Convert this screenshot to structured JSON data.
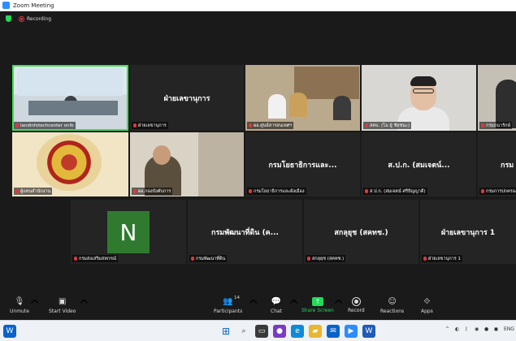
{
  "window": {
    "title": "Zoom Meeting"
  },
  "status": {
    "recording_label": "Recording"
  },
  "tiles": [
    {
      "id": "t1",
      "label": "landinfotechcenter onlb",
      "center": "",
      "active": true,
      "kind": "board"
    },
    {
      "id": "t2",
      "label": "ฝ่ายเลขานุการ",
      "center": "ฝ่ายเลขานุการ",
      "active": false,
      "kind": "blank"
    },
    {
      "id": "t3",
      "label": "ผอ.ศูนย์สารสนเทศฯ",
      "center": "",
      "active": false,
      "kind": "office"
    },
    {
      "id": "t4",
      "label": "สคบ. (โม ผู้ ชัยชนะ)",
      "center": "",
      "active": false,
      "kind": "portrait"
    },
    {
      "id": "t5",
      "label": "กรมธนารักษ์",
      "center": "",
      "active": false,
      "kind": "room"
    },
    {
      "id": "t6",
      "label": "ผู้แทนสำนักงาน",
      "center": "",
      "active": false,
      "kind": "seal"
    },
    {
      "id": "t7",
      "label": "ผอ.กองบังคับการ",
      "center": "",
      "active": false,
      "kind": "officer"
    },
    {
      "id": "t8",
      "label": "กรมโยธาธิการและผังเมือง",
      "center": "กรมโยธาธิการและ...",
      "active": false,
      "kind": "blank"
    },
    {
      "id": "t9",
      "label": "ส.ป.ก. (สมเจตน์ ศรีปัญญาดี)",
      "center": "ส.ป.ก. (สมเจตน์...",
      "active": false,
      "kind": "blank"
    },
    {
      "id": "t10",
      "label": "กรมการปกครอง",
      "center": "กรม",
      "active": false,
      "kind": "blank"
    },
    {
      "id": "t11",
      "label": "กรมส่งเสริมสหกรณ์",
      "center": "",
      "active": false,
      "kind": "avatar",
      "avatar_letter": "N"
    },
    {
      "id": "t12",
      "label": "กรมพัฒนาที่ดิน",
      "center": "กรมพัฒนาที่ดิน (ค...",
      "active": false,
      "kind": "blank"
    },
    {
      "id": "t13",
      "label": "สกลุยุช (สคทช.)",
      "center": "สกลุยุช (สคทช.)",
      "active": false,
      "kind": "blank"
    },
    {
      "id": "t14",
      "label": "ฝ่ายเลขานุการ 1",
      "center": "ฝ่ายเลขานุการ 1",
      "active": false,
      "kind": "blank"
    }
  ],
  "controls": {
    "unmute": "Unmute",
    "start_video": "Start Video",
    "participants": "Participants",
    "participants_count": "14",
    "chat": "Chat",
    "share_screen": "Share Screen",
    "record": "Record",
    "reactions": "Reactions",
    "apps": "Apps"
  },
  "taskbar": {
    "language": "ENG"
  },
  "colors": {
    "active_speaker": "#3ee04f",
    "share": "#23d959",
    "muted": "#e0383e",
    "avatar": "#2f7a2f"
  }
}
